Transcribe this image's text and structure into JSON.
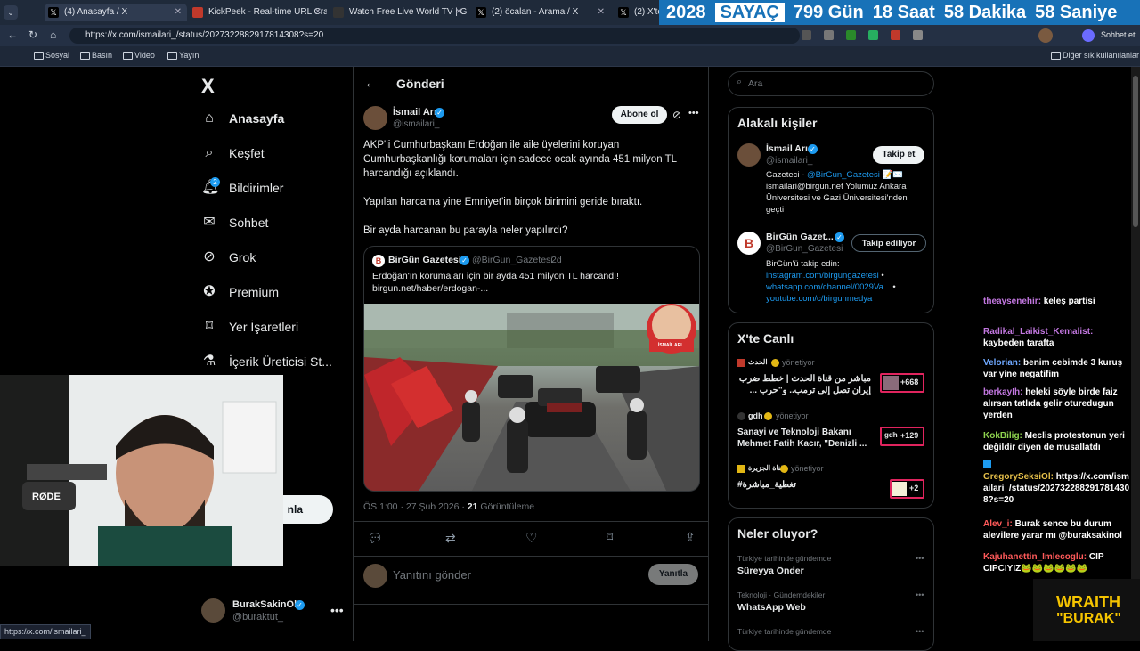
{
  "browser": {
    "tabs": [
      {
        "label": "(4) Anasayfa / X"
      },
      {
        "label": "KickPeek - Real-time URL Crawler"
      },
      {
        "label": "Watch Free Live World TV | Gl"
      },
      {
        "label": "(2) öcalan - Arama / X"
      },
      {
        "label": "(2) X'te M"
      }
    ],
    "url": "https://x.com/ismailari_/status/2027322882917814308?s=20",
    "profile_label": "Sohbet et",
    "bookmarks": [
      "Sosyal",
      "Basın",
      "Video",
      "Yayın"
    ],
    "other_bookmarks": "Diğer sık kullanılanlar",
    "status_url": "https://x.com/ismailari_"
  },
  "counter": {
    "year": "2028",
    "label": "SAYAÇ",
    "days": "799 Gün",
    "hours": "18 Saat",
    "minutes": "58 Dakika",
    "seconds": "58 Saniye"
  },
  "nav": {
    "logo": "X",
    "items": [
      {
        "label": "Anasayfa",
        "icon": "home-icon"
      },
      {
        "label": "Keşfet",
        "icon": "search-icon"
      },
      {
        "label": "Bildirimler",
        "icon": "bell-icon",
        "badge": "2"
      },
      {
        "label": "Sohbet",
        "icon": "mail-icon"
      },
      {
        "label": "Grok",
        "icon": "grok-icon"
      },
      {
        "label": "Premium",
        "icon": "premium-icon"
      },
      {
        "label": "Yer İşaretleri",
        "icon": "bookmark-icon"
      },
      {
        "label": "İçerik Üreticisi St...",
        "icon": "creator-icon"
      }
    ],
    "post_button_fragment": "nla",
    "account": {
      "name": "BurakSakinOl",
      "handle": "@buraktut_"
    }
  },
  "post": {
    "header": "Gönderi",
    "author_name": "İsmail Arı",
    "author_handle": "@ismailari_",
    "follow_label": "Abone ol",
    "text_1": "AKP'li Cumhurbaşkanı Erdoğan ile aile üyelerini koruyan Cumhurbaşkanlığı korumaları için sadece ocak ayında 451 milyon TL harcandığı açıklandı.",
    "text_2": "Yapılan harcama yine Emniyet'in birçok birimini geride bıraktı.",
    "text_3": "Bir ayda harcanan bu parayla neler yapılırdı?",
    "quote": {
      "name": "BirGün Gazetesi",
      "handle": "@BirGun_Gazetesi",
      "age": "2d",
      "text": "Erdoğan'ın korumaları için bir ayda 451 milyon TL harcandı! birgun.net/haber/erdogan-...",
      "overlay_name": "İSMAİL ARI"
    },
    "meta_time": "ÖS 1:00 · 27 Şub 2026 · ",
    "meta_views": "21",
    "meta_views_label": " Görüntüleme",
    "reply_placeholder": "Yanıtını gönder",
    "reply_button": "Yanıtla"
  },
  "sidebar": {
    "search_placeholder": "Ara",
    "related_title": "Alakalı kişiler",
    "people": [
      {
        "name": "İsmail Arı",
        "handle": "@ismailari_",
        "button": "Takip et",
        "bio_prefix": "Gazeteci - ",
        "bio_link": "@BirGun_Gazetesi",
        "bio_rest": " 📝✉️ ismailari@birgun.net Yolumuz Ankara Üniversitesi ve Gazi Üniversitesi'nden geçti"
      },
      {
        "name": "BirGün Gazet...",
        "handle": "@BirGun_Gazetesi",
        "button": "Takip ediliyor",
        "bio_prefix": "BirGün'ü takip edin:",
        "bio_link": "instagram.com/birgungazetesi",
        "bio_link2": "whatsapp.com/channel/0029Va...",
        "bio_link3": "youtube.com/c/birgunmedya"
      }
    ],
    "live_title": "X'te Canlı",
    "live": [
      {
        "host": "الحدث",
        "status": "yönetiyor",
        "title": "مباشر من قناة الحدث | خطط ضرب إيران تصل إلى ترمب.. و\"حرب ...",
        "count": "+668"
      },
      {
        "host": "gdh",
        "status": "yönetiyor",
        "title": "Sanayi ve Teknoloji Bakanı Mehmet Fatih Kacır, \"Denizli ...",
        "count": "+129",
        "thumb": "gdh"
      },
      {
        "host": "قناة الجزيرة",
        "status": "yönetiyor",
        "title": "#تغطية_مباشرة",
        "count": "+2"
      }
    ],
    "trends_title": "Neler oluyor?",
    "trends": [
      {
        "context": "Türkiye tarihinde gündemde",
        "name": "Süreyya Önder"
      },
      {
        "context": "Teknoloji · Gündemdekiler",
        "name": "WhatsApp Web"
      },
      {
        "context": "Türkiye tarihinde gündemde",
        "name": ""
      }
    ]
  },
  "chat": [
    {
      "user": "theaysenehir:",
      "msg": " keleş partisi",
      "color": "#c277e0"
    },
    {
      "user": "Radikal_Laikist_Kemalist:",
      "msg": " kaybeden tarafta",
      "color": "#c277e0"
    },
    {
      "user": "Velorian:",
      "msg": " benim cebimde 3 kuruş var yine negatifim",
      "color": "#6ea8ff"
    },
    {
      "user": "berkayIh:",
      "msg": " heleki söyle birde faiz alırsan tatlıda gelir oturedugun yerden",
      "color": "#c277e0"
    },
    {
      "user": "KokBilig:",
      "msg": " Meclis protestonun yeri değildir diyen de musallatdı",
      "color": "#8fd44f"
    },
    {
      "user": "GregorySeksiOl:",
      "msg": " https://x.com/ismailari_/status/2027322882917814308?s=20",
      "color": "#e6c04a"
    },
    {
      "user": "Alev_i:",
      "msg": " Burak sence bu durum alevilere yarar mı @buraksakinol",
      "color": "#ff5a5a"
    },
    {
      "user": "Kajuhanettin_Imlecoglu:",
      "msg": " CIP CIPCIYIZ🐸🐸🐸🐸🐸🐸",
      "color": "#ff5a5a"
    }
  ],
  "overlay": {
    "brand_line1": "WRAITH",
    "brand_line2": "\"BURAK\"",
    "mic_label": "RØDE"
  },
  "colors": {
    "accent": "#1d9bf0",
    "counter_bg": "#1872b8",
    "background": "#000000"
  }
}
